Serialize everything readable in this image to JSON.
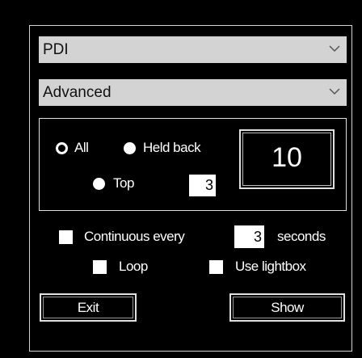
{
  "dropdowns": [
    {
      "value": "PDI"
    },
    {
      "value": "Advanced"
    }
  ],
  "options": {
    "radio_all": "All",
    "radio_held_back": "Held back",
    "radio_top": "Top",
    "top_count": "3",
    "display_value": "10"
  },
  "continuous": {
    "label": "Continuous every",
    "interval": "3",
    "unit": "seconds"
  },
  "checkboxes": {
    "loop": "Loop",
    "lightbox": "Use lightbox"
  },
  "buttons": {
    "exit": "Exit",
    "show": "Show"
  }
}
